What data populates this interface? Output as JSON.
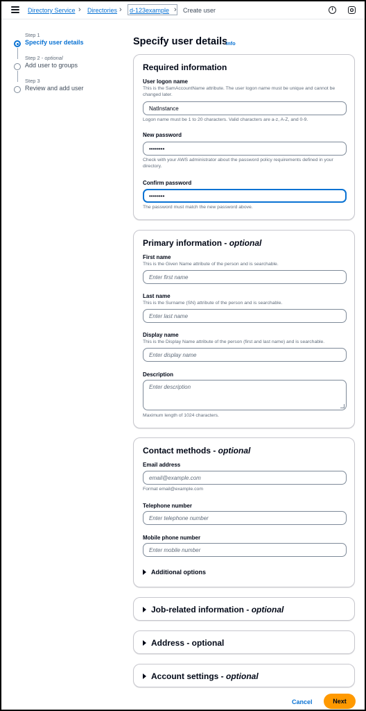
{
  "breadcrumbs": {
    "items": [
      "Directory Service",
      "Directories",
      "d-123example"
    ],
    "current": "Create user"
  },
  "header_icons": {
    "info": "i",
    "settings": "settings-icon"
  },
  "steps": [
    {
      "number": "Step 1",
      "optional": "",
      "label": "Specify user details",
      "active": true
    },
    {
      "number": "Step 2 - ",
      "optional": "optional",
      "label": "Add user to groups",
      "active": false
    },
    {
      "number": "Step 3",
      "optional": "",
      "label": "Review and add user",
      "active": false
    }
  ],
  "page": {
    "title": "Specify user details",
    "info": "Info"
  },
  "required": {
    "title": "Required information",
    "logon_label": "User logon name",
    "logon_desc": "This is the SamAccountName attribute. The user logon name must be unique and cannot be changed later.",
    "logon_value": "NatInstance",
    "logon_hint": "Logon name must be 1 to 20 characters. Valid characters are a-z, A-Z, and 0-9.",
    "password_label": "New password",
    "password_value": "••••••••",
    "password_hint": "Check with your AWS administrator about the password policy requirements defined in your directory.",
    "confirm_label": "Confirm password",
    "confirm_value": "••••••••",
    "confirm_hint": "The password must match the new password above."
  },
  "primary": {
    "title": "Primary information - ",
    "title_optional": "optional",
    "first_label": "First name",
    "first_desc": "This is the Given Name attribute of the person and is searchable.",
    "first_placeholder": "Enter first name",
    "last_label": "Last name",
    "last_desc": "This is the Surname (SN) attribute of the person and is searchable.",
    "last_placeholder": "Enter last name",
    "display_label": "Display name",
    "display_desc": "This is the Display Name attribute of the person (first and last name) and is searchable.",
    "display_placeholder": "Enter display name",
    "description_label": "Description",
    "description_placeholder": "Enter description",
    "description_hint": "Maximum length of 1024 characters."
  },
  "contact": {
    "title": "Contact methods - ",
    "title_optional": "optional",
    "email_label": "Email address",
    "email_placeholder": "email@example.com",
    "email_hint": "Format email@example.com",
    "phone_label": "Telephone number",
    "phone_placeholder": "Enter telephone number",
    "mobile_label": "Mobile phone number",
    "mobile_placeholder": "Enter mobile number",
    "additional": "Additional options"
  },
  "collapsed_sections": [
    {
      "title": "Job-related information - ",
      "optional": "optional"
    },
    {
      "title": "Address - optional",
      "optional": ""
    },
    {
      "title": "Account settings - ",
      "optional": "optional"
    }
  ],
  "actions": {
    "cancel": "Cancel",
    "next": "Next"
  }
}
